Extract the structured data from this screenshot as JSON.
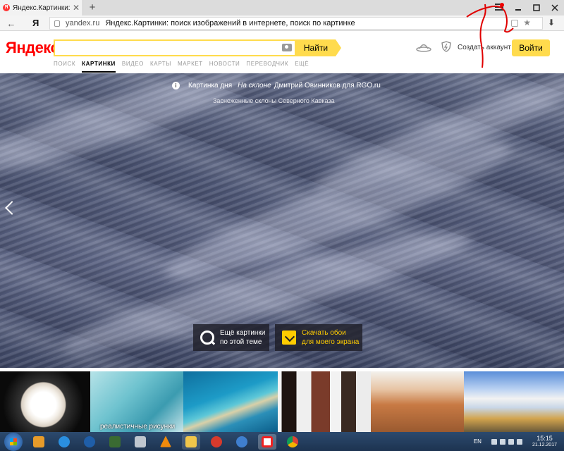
{
  "browser": {
    "tab_title": "Яндекс.Картинки: поиск",
    "address_domain": "yandex.ru",
    "page_title": "Яндекс.Картинки: поиск изображений в интернете, поиск по картинке",
    "yandex_button": "Я"
  },
  "header": {
    "logo": "Яндекс",
    "search_placeholder": "",
    "find_label": "Найти",
    "nav": [
      "ПОИСК",
      "КАРТИНКИ",
      "ВИДЕО",
      "КАРТЫ",
      "МАРКЕТ",
      "НОВОСТИ",
      "ПЕРЕВОДЧИК",
      "ЕЩЁ"
    ],
    "active_nav": "КАРТИНКИ",
    "create_account": "Создать аккаунт",
    "login": "Войти"
  },
  "hero": {
    "caption_label": "Картинка дня",
    "caption_title": "На склоне",
    "caption_author": "Дмитрий Овинников для RGO.ru",
    "subcaption": "Заснеженные склоны Северного Кавказа",
    "more_line1": "Ещё картинки",
    "more_line2": "по этой теме",
    "download_line1": "Скачать обои",
    "download_line2": "для моего экрана"
  },
  "thumbnails": [
    {
      "label": "",
      "icon": "pomeranian-dog"
    },
    {
      "label": "реалистичные рисунки",
      "icon": "cat-drawing"
    },
    {
      "label": "",
      "icon": "tropical-reef"
    },
    {
      "label": "",
      "icon": "fashion-outfits"
    },
    {
      "label": "",
      "icon": "mars-surface"
    },
    {
      "label": "",
      "icon": "geyser-landscape"
    }
  ],
  "taskbar": {
    "lang": "EN",
    "time": "15:15",
    "date": "21.12.2017"
  },
  "colors": {
    "yandex_yellow": "#ffdb4d",
    "yandex_red": "#ff0000",
    "annotation_red": "#e00000"
  }
}
